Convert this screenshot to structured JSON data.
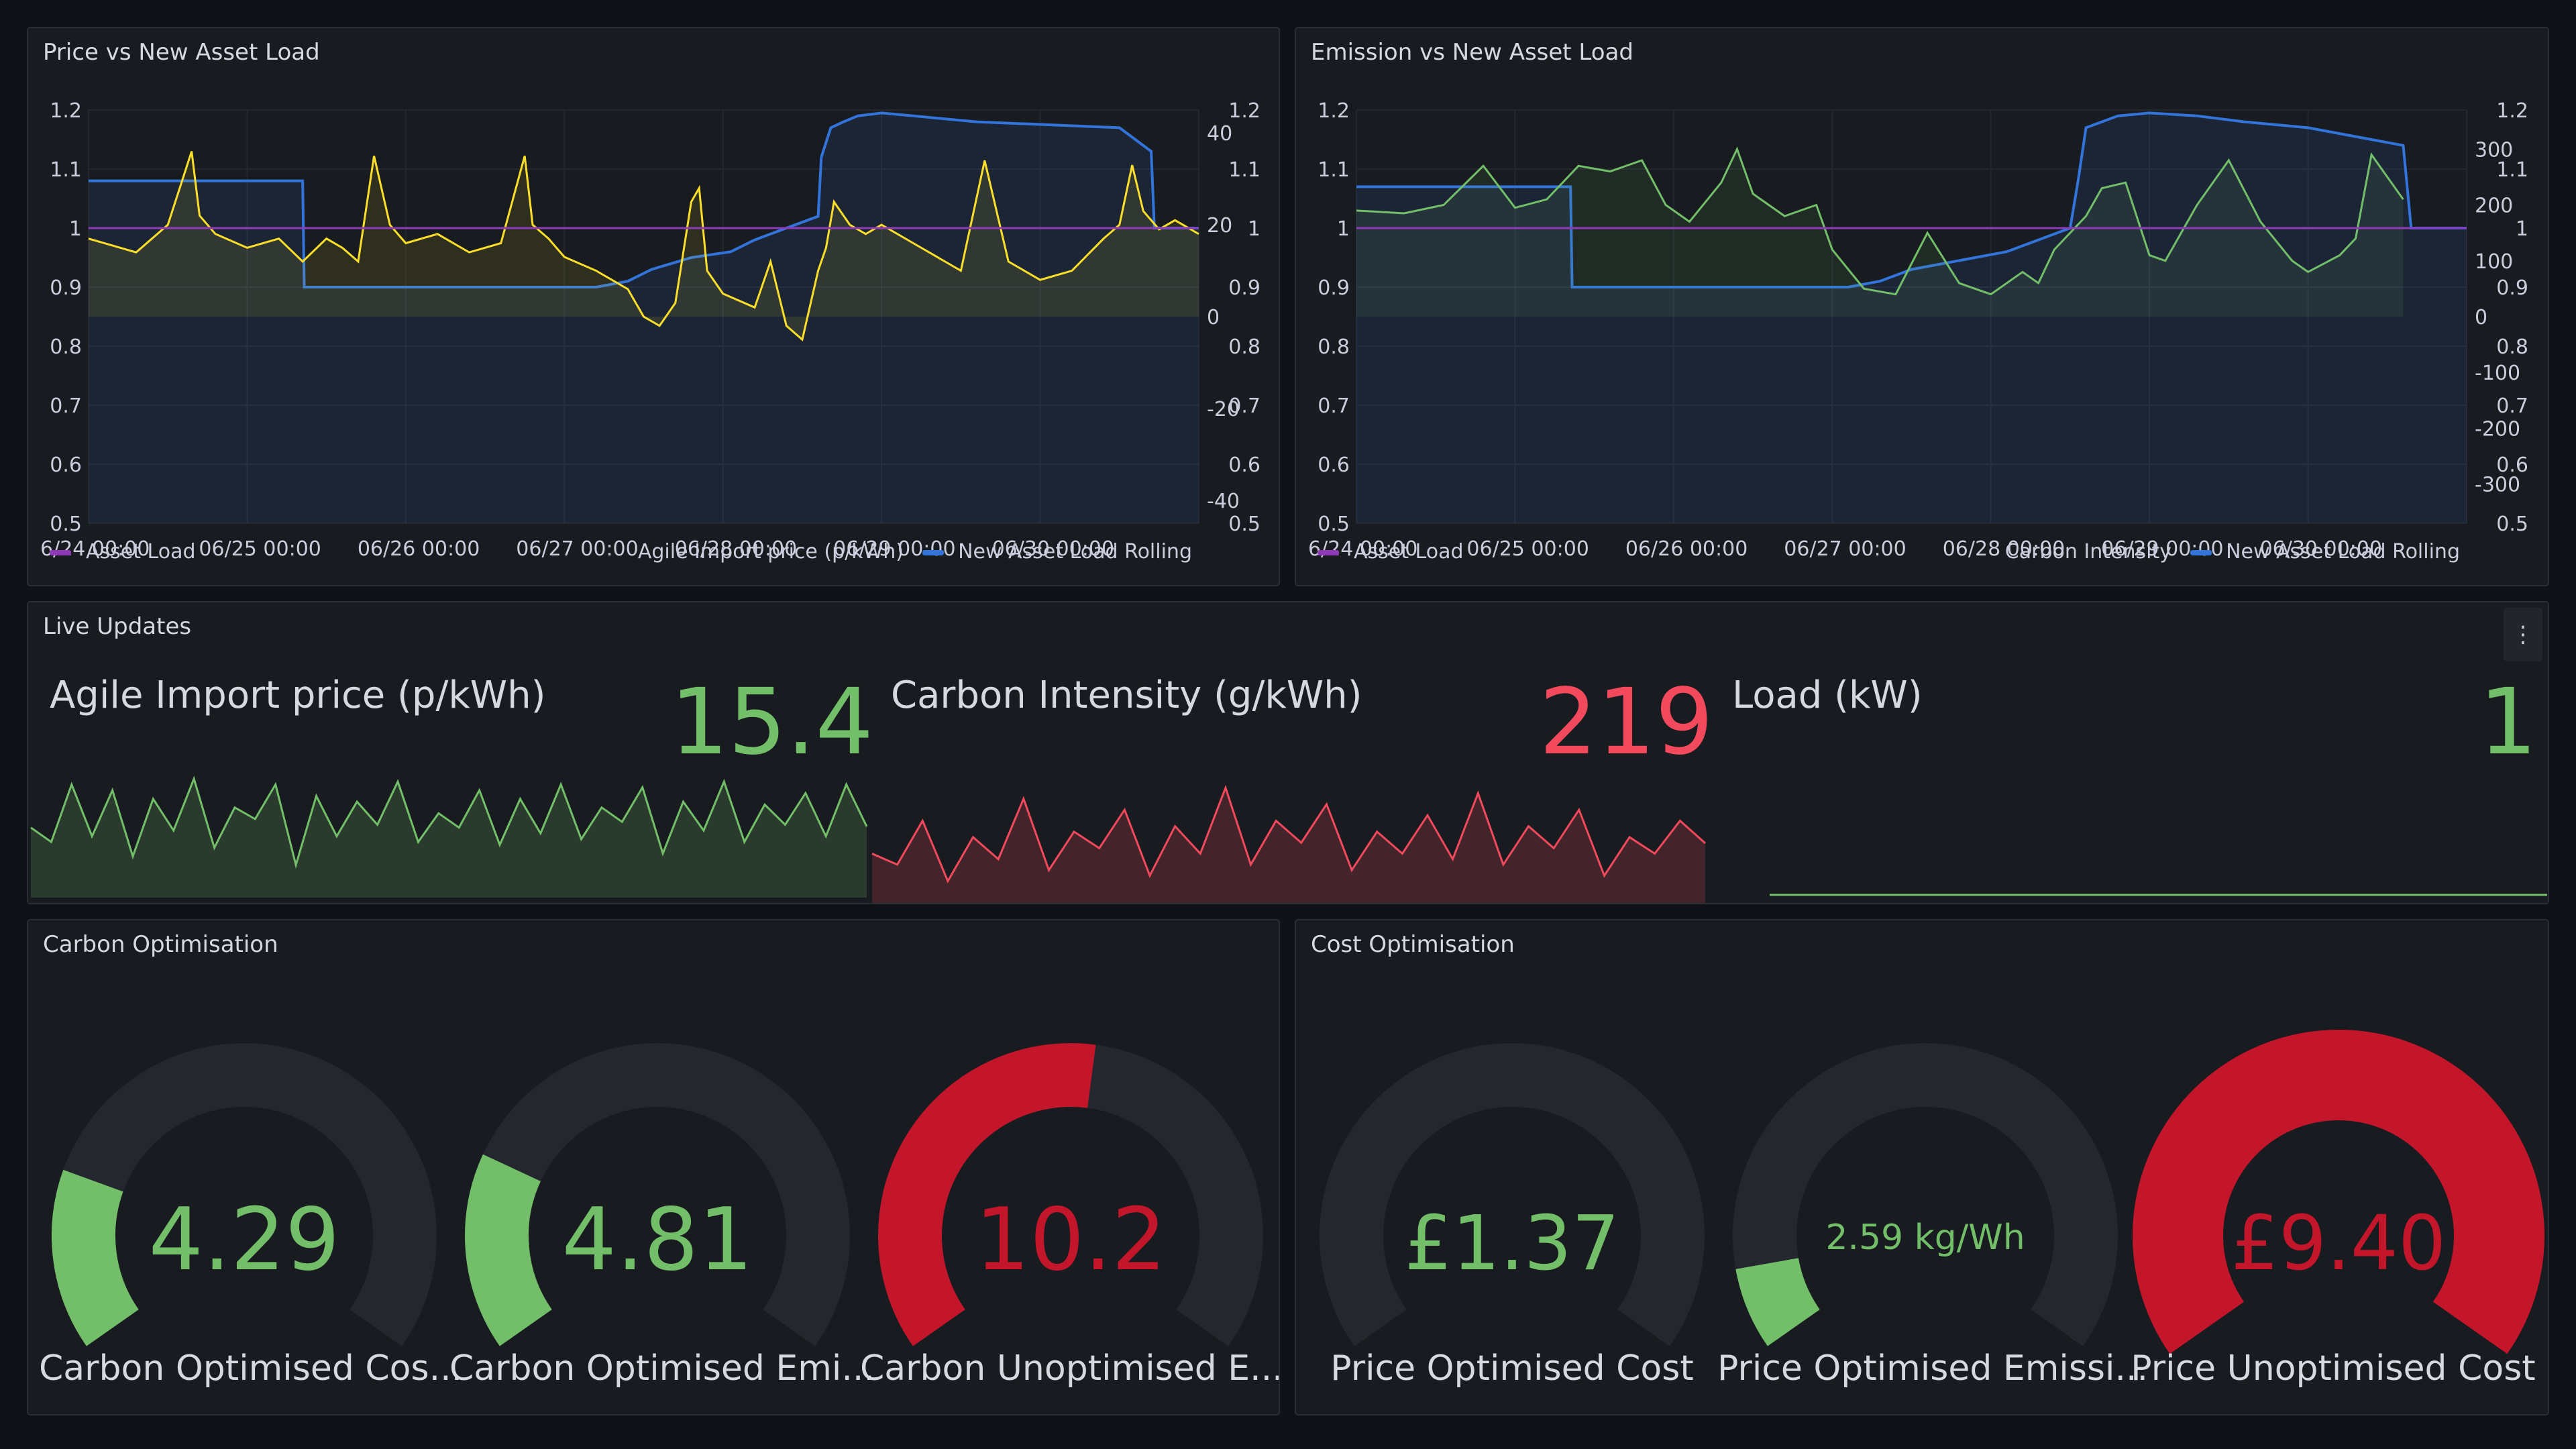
{
  "panels": {
    "price": {
      "title": "Price vs New Asset Load",
      "legend": {
        "asset_load": "Asset Load",
        "agile": "Agile Import price (p/kWh)",
        "rolling": "New Asset Load Rolling"
      }
    },
    "emission": {
      "title": "Emission vs New Asset Load",
      "legend": {
        "asset_load": "Asset Load",
        "carbon": "Carbon Intensity",
        "rolling": "New Asset Load Rolling"
      }
    },
    "live": {
      "title": "Live Updates",
      "menu_icon": "⋮",
      "stats": [
        {
          "title": "Agile Import price (p/kWh)",
          "value": "15.4",
          "color": "#73bf69"
        },
        {
          "title": "Carbon Intensity (g/kWh)",
          "value": "219",
          "color": "#f2495c"
        },
        {
          "title": "Load (kW)",
          "value": "1",
          "color": "#73bf69"
        }
      ]
    },
    "carbon_opt": {
      "title": "Carbon Optimisation",
      "gauges": [
        {
          "value": "4.29",
          "label": "Carbon Optimised Cos...",
          "fraction": 0.22,
          "color": "#73bf69"
        },
        {
          "value": "4.81",
          "label": "Carbon Optimised Emi...",
          "fraction": 0.24,
          "color": "#73bf69"
        },
        {
          "value": "10.2",
          "label": "Carbon Unoptimised E...",
          "fraction": 0.53,
          "color": "#c4162a"
        }
      ]
    },
    "cost_opt": {
      "title": "Cost Optimisation",
      "gauges": [
        {
          "value": "£1.37",
          "label": "Price Optimised Cost",
          "fraction": 0.0,
          "color": "#73bf69"
        },
        {
          "value": "2.59 kg/Wh",
          "label": "Price Optimised Emissi...",
          "fraction": 0.1,
          "color": "#73bf69"
        },
        {
          "value": "£9.40",
          "label": "Price Unoptimised Cost",
          "fraction": 1.0,
          "color": "#c4162a"
        }
      ]
    }
  },
  "colors": {
    "asset_load": "#8f3bb8",
    "agile": "#fade2a",
    "rolling": "#3274d9",
    "carbon": "#73bf69",
    "stat_green": "#73bf69",
    "stat_red": "#f2495c",
    "gauge_red": "#c4162a"
  },
  "chart_data": [
    {
      "type": "line",
      "title": "Price vs New Asset Load",
      "x_ticks": [
        "6/24 00:00",
        "06/25 00:00",
        "06/26 00:00",
        "06/27 00:00",
        "06/28 00:00",
        "06/29 00:00",
        "06/30 00:00"
      ],
      "y_left_ticks": [
        "1.2",
        "1.1",
        "1",
        "0.9",
        "0.8",
        "0.7",
        "0.6",
        "0.5"
      ],
      "y_right_price_ticks": [
        "40",
        "20",
        "0",
        "-20",
        "-40"
      ],
      "y_right_load_ticks": [
        "1.2",
        "1.1",
        "1",
        "0.9",
        "0.8",
        "0.7",
        "0.6",
        "0.5"
      ],
      "ylim_left": [
        0.5,
        1.2
      ],
      "ylim_price": [
        -45,
        45
      ],
      "series": [
        {
          "name": "Asset Load",
          "x": [
            0,
            7
          ],
          "values": [
            1,
            1
          ]
        },
        {
          "name": "New Asset Load Rolling",
          "x": [
            0,
            1.35,
            1.36,
            3.2,
            3.4,
            3.55,
            3.8,
            4.05,
            4.2,
            4.4,
            4.6,
            4.62,
            4.68,
            4.76,
            4.85,
            5.0,
            5.2,
            5.6,
            6.5,
            6.6,
            6.7,
            6.72,
            7
          ],
          "values": [
            1.08,
            1.08,
            0.9,
            0.9,
            0.91,
            0.93,
            0.95,
            0.96,
            0.98,
            1.0,
            1.02,
            1.12,
            1.17,
            1.18,
            1.19,
            1.195,
            1.19,
            1.18,
            1.17,
            1.15,
            1.13,
            1.0,
            1.0
          ]
        },
        {
          "name": "Agile Import price (p/kWh)",
          "x": [
            0,
            0.3,
            0.5,
            0.65,
            0.7,
            0.8,
            1.0,
            1.2,
            1.35,
            1.5,
            1.6,
            1.7,
            1.8,
            1.9,
            2.0,
            2.2,
            2.4,
            2.6,
            2.75,
            2.8,
            2.9,
            3.0,
            3.2,
            3.4,
            3.5,
            3.6,
            3.7,
            3.8,
            3.85,
            3.9,
            4.0,
            4.2,
            4.3,
            4.4,
            4.5,
            4.6,
            4.65,
            4.7,
            4.8,
            4.9,
            5.0,
            5.2,
            5.4,
            5.5,
            5.65,
            5.8,
            6.0,
            6.2,
            6.4,
            6.5,
            6.58,
            6.65,
            6.75,
            6.85,
            7
          ],
          "values": [
            17,
            14,
            20,
            36,
            22,
            18,
            15,
            17,
            12,
            17,
            15,
            12,
            35,
            20,
            16,
            18,
            14,
            16,
            35,
            20,
            17,
            13,
            10,
            6,
            0,
            -2,
            3,
            25,
            28,
            10,
            5,
            2,
            12,
            -2,
            -5,
            10,
            15,
            25,
            20,
            18,
            20,
            16,
            12,
            10,
            34,
            12,
            8,
            10,
            17,
            20,
            33,
            23,
            19,
            21,
            18
          ]
        }
      ]
    },
    {
      "type": "line",
      "title": "Emission vs New Asset Load",
      "x_ticks": [
        "6/24 00:00",
        "06/25 00:00",
        "06/26 00:00",
        "06/27 00:00",
        "06/28 00:00",
        "06/29 00:00",
        "06/30 00:00"
      ],
      "y_left_ticks": [
        "1.2",
        "1.1",
        "1",
        "0.9",
        "0.8",
        "0.7",
        "0.6",
        "0.5"
      ],
      "y_right_carbon_ticks": [
        "300",
        "200",
        "100",
        "0",
        "-100",
        "-200",
        "-300"
      ],
      "y_right_load_ticks": [
        "1.2",
        "1.1",
        "1",
        "0.9",
        "0.8",
        "0.7",
        "0.6",
        "0.5"
      ],
      "ylim_left": [
        0.5,
        1.2
      ],
      "ylim_carbon": [
        -370,
        370
      ],
      "series": [
        {
          "name": "Asset Load",
          "x": [
            0,
            7
          ],
          "values": [
            1,
            1
          ]
        },
        {
          "name": "New Asset Load Rolling",
          "x": [
            0,
            1.35,
            1.36,
            3.1,
            3.3,
            3.5,
            3.7,
            3.9,
            4.1,
            4.3,
            4.5,
            4.55,
            4.6,
            4.7,
            4.8,
            5.0,
            5.3,
            5.6,
            6.0,
            6.4,
            6.6,
            6.65,
            7
          ],
          "values": [
            1.07,
            1.07,
            0.9,
            0.9,
            0.91,
            0.93,
            0.94,
            0.95,
            0.96,
            0.98,
            1.0,
            1.08,
            1.17,
            1.18,
            1.19,
            1.195,
            1.19,
            1.18,
            1.17,
            1.15,
            1.14,
            1.0,
            1.0
          ]
        },
        {
          "name": "Carbon Intensity",
          "x": [
            0,
            0.3,
            0.55,
            0.8,
            1.0,
            1.2,
            1.4,
            1.6,
            1.8,
            1.95,
            2.1,
            2.3,
            2.4,
            2.5,
            2.7,
            2.9,
            3.0,
            3.2,
            3.4,
            3.6,
            3.8,
            4.0,
            4.2,
            4.3,
            4.4,
            4.6,
            4.7,
            4.85,
            5.0,
            5.1,
            5.3,
            5.5,
            5.7,
            5.9,
            6.0,
            6.2,
            6.3,
            6.4,
            6.6
          ],
          "values": [
            190,
            185,
            200,
            270,
            195,
            210,
            270,
            260,
            280,
            200,
            170,
            240,
            300,
            220,
            180,
            200,
            120,
            50,
            40,
            150,
            60,
            40,
            80,
            60,
            120,
            180,
            230,
            240,
            110,
            100,
            200,
            280,
            170,
            100,
            80,
            110,
            140,
            290,
            210
          ]
        }
      ]
    },
    {
      "type": "area",
      "title": "Agile Import price (p/kWh)",
      "values": [
        15,
        10,
        30,
        12,
        28,
        5,
        25,
        14,
        32,
        8,
        22,
        18,
        30,
        2,
        26,
        12,
        24,
        16,
        31,
        10,
        20,
        15,
        28,
        9,
        25,
        13,
        30,
        11,
        22,
        17,
        29,
        6,
        24,
        14,
        31,
        10,
        23,
        16,
        27,
        12,
        30,
        15.4
      ]
    },
    {
      "type": "area",
      "title": "Carbon Intensity (g/kWh)",
      "values": [
        200,
        180,
        260,
        150,
        230,
        190,
        300,
        170,
        240,
        210,
        280,
        160,
        250,
        200,
        320,
        180,
        260,
        220,
        290,
        170,
        240,
        200,
        270,
        190,
        310,
        180,
        250,
        210,
        280,
        160,
        230,
        200,
        260,
        219
      ]
    },
    {
      "type": "area",
      "title": "Load (kW)",
      "values": [
        1,
        1,
        1,
        1,
        1,
        1,
        1,
        1
      ]
    }
  ]
}
